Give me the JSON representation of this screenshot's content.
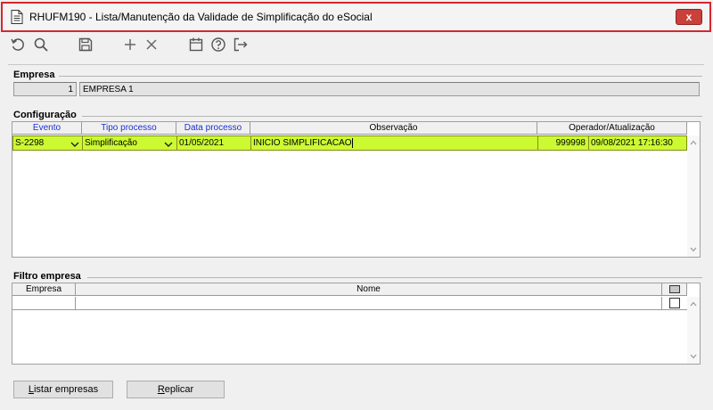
{
  "window": {
    "title": "RHUFM190 - Lista/Manutenção da Validade de Simplificação do eSocial",
    "close_label": "x"
  },
  "toolbar": {
    "items": [
      "refresh-icon",
      "search-icon",
      "save-icon",
      "add-icon",
      "delete-icon",
      "calendar-icon",
      "help-icon",
      "exit-icon"
    ]
  },
  "empresa": {
    "label": "Empresa",
    "code": "1",
    "name": "EMPRESA 1"
  },
  "configuracao": {
    "label": "Configuração",
    "columns": [
      "Evento",
      "Tipo processo",
      "Data processo",
      "Observação",
      "Operador/Atualização"
    ],
    "rows": [
      {
        "evento": "S-2298",
        "tipo_processo": "Simplificação",
        "data_processo": "01/05/2021",
        "observacao": "INICIO SIMPLIFICACAO",
        "operador": "999998",
        "atualizacao": "09/08/2021 17:16:30"
      }
    ]
  },
  "filtro": {
    "label": "Filtro empresa",
    "columns": [
      "Empresa",
      "Nome"
    ],
    "rows": [
      {
        "empresa": "",
        "nome": "",
        "checked": false
      }
    ]
  },
  "buttons": {
    "listar_prefix": "L",
    "listar_rest": "istar empresas",
    "replicar_prefix": "R",
    "replicar_rest": "eplicar"
  },
  "colors": {
    "title_border": "#d4282d",
    "highlight_row": "#ccfa32",
    "header_link": "#1c2fcf"
  }
}
